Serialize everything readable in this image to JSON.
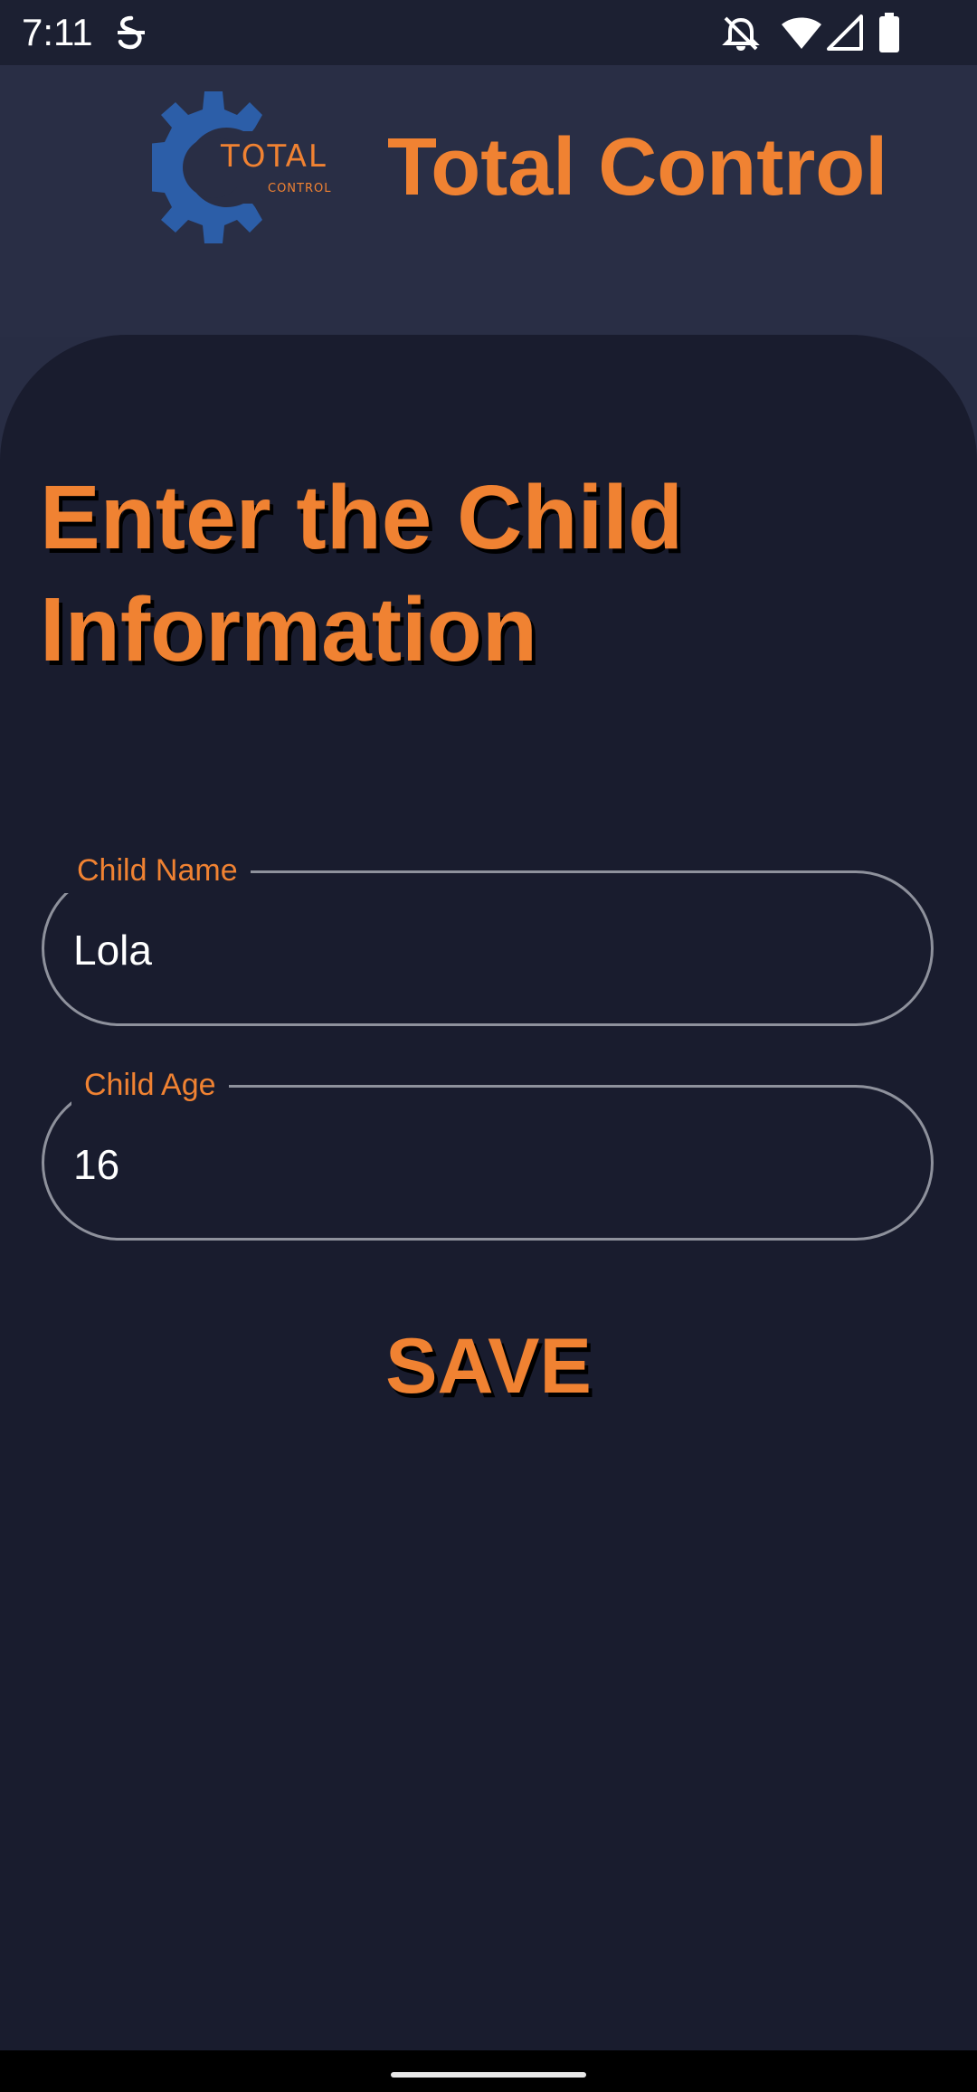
{
  "status_bar": {
    "time": "7:11",
    "icons": [
      "notification-s-icon",
      "bell-off-icon",
      "wifi-icon",
      "signal-icon",
      "battery-icon"
    ]
  },
  "header": {
    "logo": {
      "word_top": "TOTAL",
      "word_bottom": "CONTROL",
      "gear_color": "#2c5ea8"
    },
    "app_title": "Total Control"
  },
  "form": {
    "title": "Enter the Child Information",
    "fields": [
      {
        "label": "Child Name",
        "value": "Lola"
      },
      {
        "label": "Child Age",
        "value": "16"
      }
    ],
    "save_label": "SAVE"
  },
  "colors": {
    "accent": "#f08232",
    "background": "#191c2e",
    "header": "#292e45",
    "field_border": "#8e919c"
  }
}
